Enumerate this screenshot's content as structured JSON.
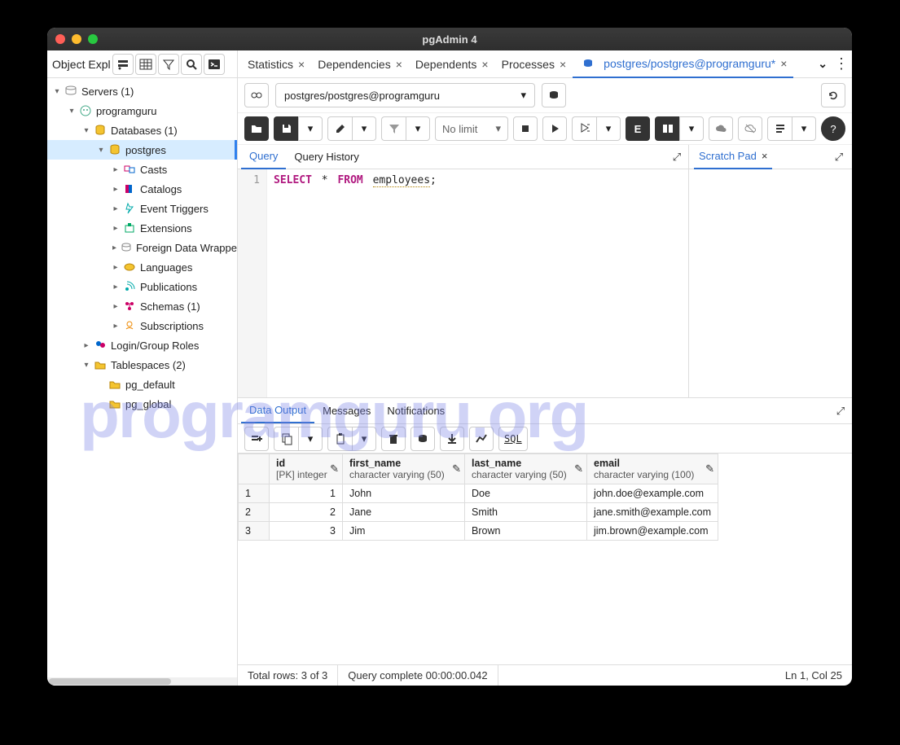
{
  "window": {
    "title": "pgAdmin 4"
  },
  "sidebar": {
    "label": "Object Expl",
    "tree": {
      "servers": "Servers (1)",
      "server_name": "programguru",
      "databases": "Databases (1)",
      "db_name": "postgres",
      "casts": "Casts",
      "catalogs": "Catalogs",
      "event_triggers": "Event Triggers",
      "extensions": "Extensions",
      "fdw": "Foreign Data Wrappe",
      "languages": "Languages",
      "publications": "Publications",
      "schemas": "Schemas (1)",
      "subscriptions": "Subscriptions",
      "login_roles": "Login/Group Roles",
      "tablespaces": "Tablespaces (2)",
      "ts_default": "pg_default",
      "ts_global": "pg_global"
    }
  },
  "tabs": {
    "statistics": "Statistics",
    "dependencies": "Dependencies",
    "dependents": "Dependents",
    "processes": "Processes",
    "query_tab": "postgres/postgres@programguru*"
  },
  "connection": "postgres/postgres@programguru",
  "toolbar": {
    "limit": "No limit"
  },
  "editor": {
    "tab_query": "Query",
    "tab_history": "Query History",
    "line_no": "1",
    "kw_select": "SELECT",
    "star": "*",
    "kw_from": "FROM",
    "ident": "employees",
    "semi": ";",
    "scratch": "Scratch Pad"
  },
  "output": {
    "tab_data": "Data Output",
    "tab_messages": "Messages",
    "tab_notifications": "Notifications",
    "sql_label": "SQL",
    "columns": [
      {
        "name": "id",
        "type": "[PK] integer"
      },
      {
        "name": "first_name",
        "type": "character varying (50)"
      },
      {
        "name": "last_name",
        "type": "character varying (50)"
      },
      {
        "name": "email",
        "type": "character varying (100)"
      }
    ],
    "rows": [
      {
        "n": "1",
        "id": "1",
        "first_name": "John",
        "last_name": "Doe",
        "email": "john.doe@example.com"
      },
      {
        "n": "2",
        "id": "2",
        "first_name": "Jane",
        "last_name": "Smith",
        "email": "jane.smith@example.com"
      },
      {
        "n": "3",
        "id": "3",
        "first_name": "Jim",
        "last_name": "Brown",
        "email": "jim.brown@example.com"
      }
    ]
  },
  "status": {
    "total_rows": "Total rows: 3 of 3",
    "query_time": "Query complete 00:00:00.042",
    "cursor": "Ln 1, Col 25"
  },
  "watermark": "programguru.org"
}
